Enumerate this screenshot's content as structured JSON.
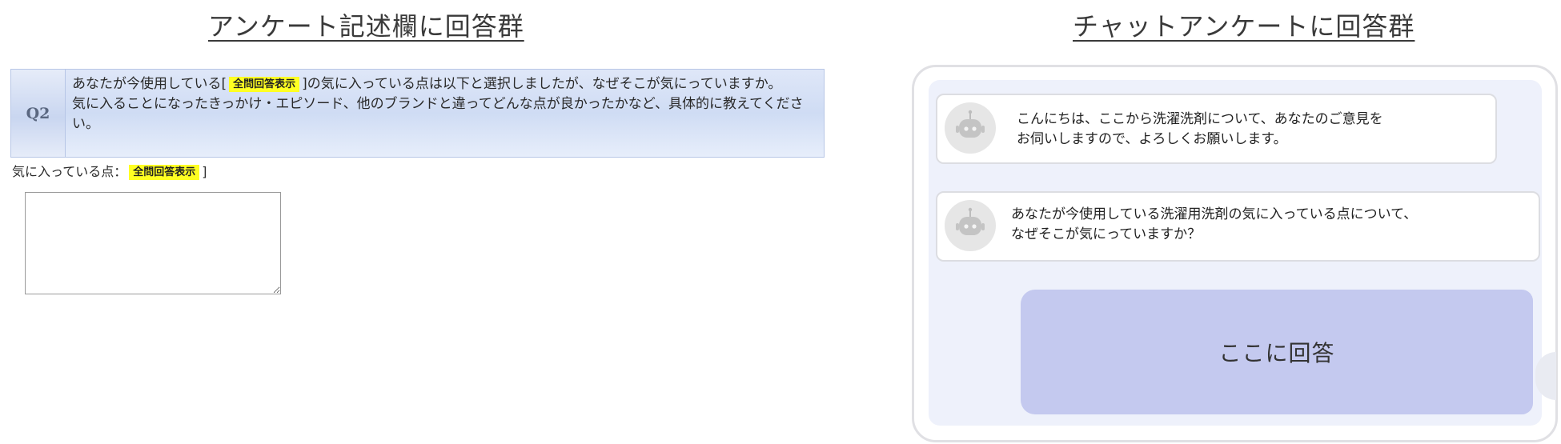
{
  "left_heading": "アンケート記述欄に回答群",
  "right_heading": "チャットアンケートに回答群",
  "question": {
    "number": "Q2",
    "line1_pre": "あなたが今使用している[",
    "highlight_label": "全問回答表示",
    "line1_post": "]の気に入っている点は以下と選択しましたが、なぜそこが気にっていますか。",
    "line2": "気に入ることになったきっかけ・エピソード、他のブランドと違ってどんな点が良かったかなど、具体的に教えてください。"
  },
  "favorite_line": {
    "label": "気に入っている点：",
    "highlight_label": "全問回答表示",
    "close_bracket": "]"
  },
  "answer_box": {
    "value": ""
  },
  "chat": {
    "bubble1_line1": "こんにちは、ここから洗濯洗剤について、あなたのご意見を",
    "bubble1_line2": "お伺いしますので、よろしくお願いします。",
    "bubble2_line1": "あなたが今使用している洗濯用洗剤の気に入っている点について、",
    "bubble2_line2": "なぜそこが気にっていますか？",
    "reply_placeholder": "ここに回答"
  },
  "colors": {
    "highlight": "#ffff22",
    "question_bg": "#d6e0f5",
    "chat_bg": "#eef1fb",
    "reply_bg": "#c4c9ef"
  },
  "icons": [
    "robot-icon"
  ]
}
